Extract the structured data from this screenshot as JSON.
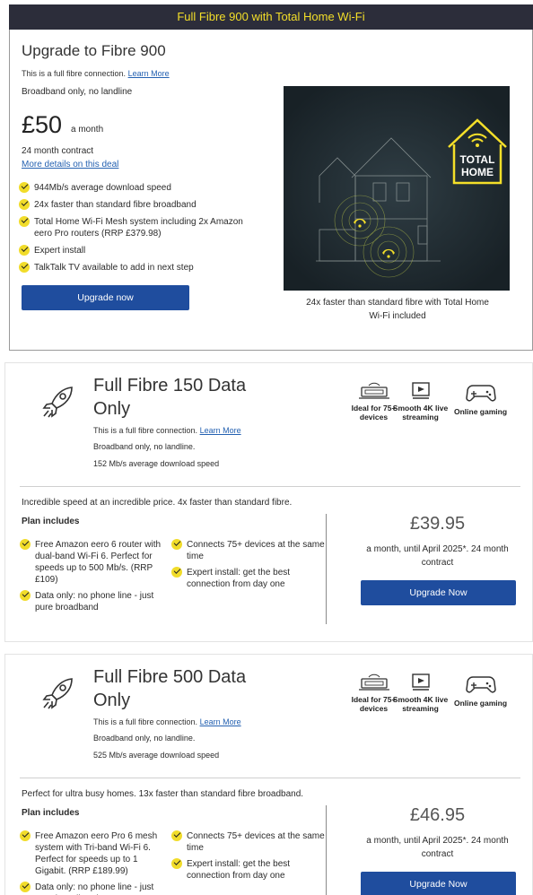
{
  "banner": {
    "title": "Full Fibre 900 with Total Home Wi-Fi"
  },
  "upgrade": {
    "title": "Upgrade to Fibre 900",
    "connection_text": "This is a full fibre connection.",
    "learn_more": "Learn More",
    "broadband": "Broadband only, no landline",
    "price": "£50",
    "price_period": "a month",
    "contract": "24 month contract",
    "details_link": "More details on this deal",
    "features": [
      "944Mb/s average download speed",
      "24x faster than standard fibre broadband",
      "Total Home Wi-Fi Mesh system including 2x Amazon eero Pro routers (RRP £379.98)",
      "Expert install",
      "TalkTalk TV available to add in next step"
    ],
    "button": "Upgrade now",
    "image_logo": "TOTAL HOME",
    "image_caption": "24x faster than standard fibre with Total Home Wi-Fi included",
    "accent": "#f4df29"
  },
  "plans": [
    {
      "title": "Full Fibre 150 Data Only",
      "connection_text": "This is a full fibre connection.",
      "learn_more": "Learn More",
      "broadband": "Broadband only, no landline.",
      "speed": "152 Mb/s average download speed",
      "icons": [
        {
          "icon": "router-devices-icon",
          "label": "Ideal for 75+ devices"
        },
        {
          "icon": "streaming-icon",
          "label": "Smooth 4K live streaming"
        },
        {
          "icon": "gamepad-icon",
          "label": "Online gaming"
        }
      ],
      "description": "Incredible speed at an incredible price. 4x faster than standard fibre.",
      "includes_label": "Plan includes",
      "left_features": [
        "Free Amazon eero 6 router with dual-band Wi-Fi 6. Perfect for speeds up to 500 Mb/s. (RRP £109)",
        "Data only: no phone line - just pure broadband"
      ],
      "right_features": [
        "Connects 75+ devices at the same time",
        "Expert install: get the best connection from day one"
      ],
      "price": "£39.95",
      "price_sub": "a month, until April 2025*. 24 month contract",
      "button": "Upgrade Now"
    },
    {
      "title": "Full Fibre 500 Data Only",
      "connection_text": "This is a full fibre connection.",
      "learn_more": "Learn More",
      "broadband": "Broadband only, no landline.",
      "speed": "525 Mb/s average download speed",
      "icons": [
        {
          "icon": "router-devices-icon",
          "label": "Ideal for 75+ devices"
        },
        {
          "icon": "streaming-icon",
          "label": "Smooth 4K live streaming"
        },
        {
          "icon": "gamepad-icon",
          "label": "Online gaming"
        }
      ],
      "description": "Perfect for ultra busy homes. 13x faster than standard fibre broadband.",
      "includes_label": "Plan includes",
      "left_features": [
        "Free Amazon eero Pro 6 mesh system with Tri-band Wi-Fi 6. Perfect for speeds up to 1 Gigabit. (RRP £189.99)",
        "Data only: no phone line - just pure broadband"
      ],
      "right_features": [
        "Connects 75+ devices at the same time",
        "Expert install: get the best connection from day one"
      ],
      "price": "£46.95",
      "price_sub": "a month, until April 2025*. 24 month contract",
      "button": "Upgrade Now"
    }
  ]
}
